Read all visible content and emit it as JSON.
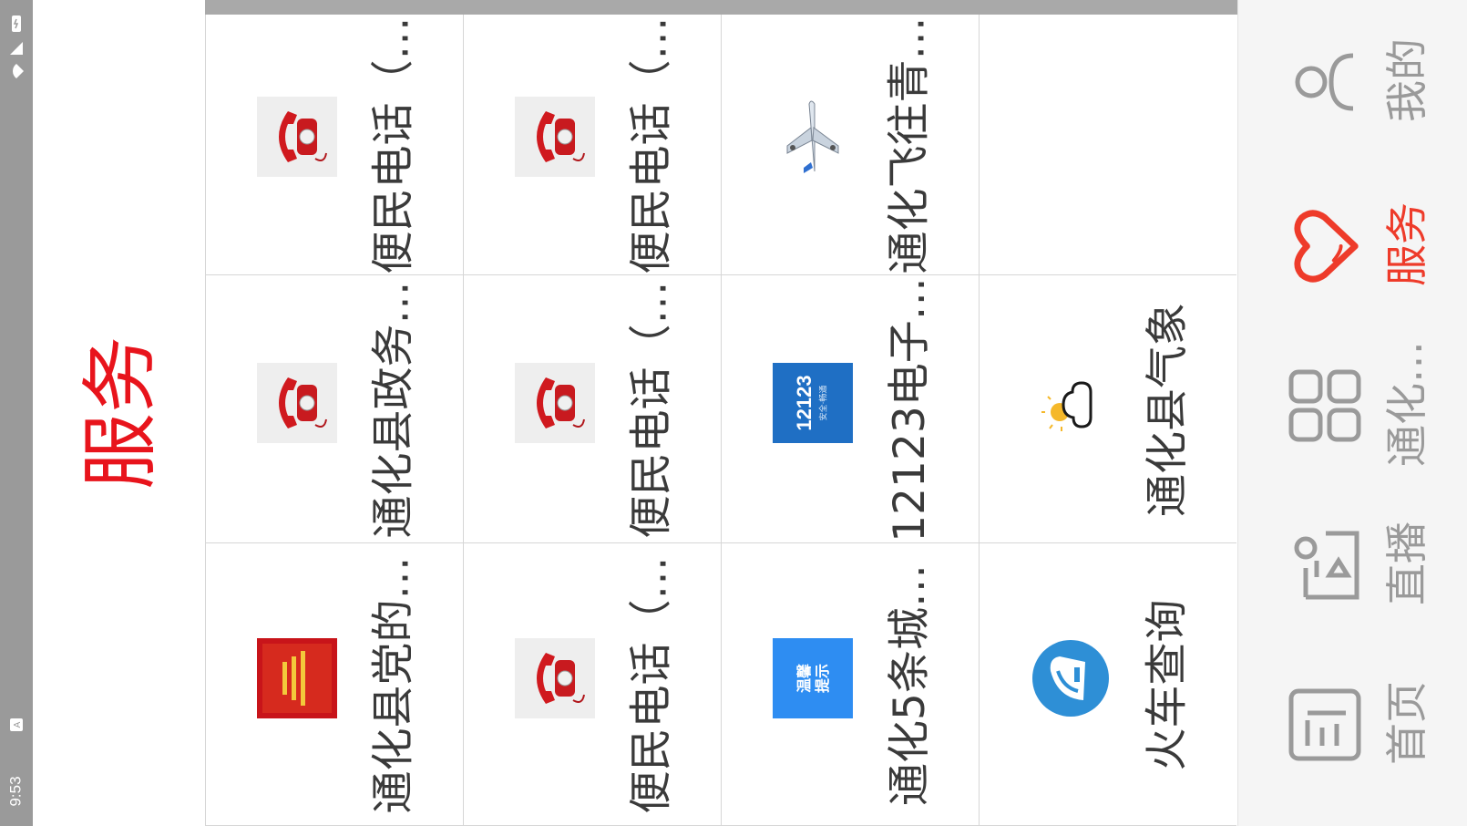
{
  "status_bar": {
    "time": "9:53",
    "notification_icon": "text-a-icon",
    "icons": [
      "battery-icon",
      "cellular-signal-icon",
      "wifi-icon"
    ]
  },
  "page_title": "服务",
  "accent_color": "#e8141c",
  "services": [
    {
      "label": "通化县党的…",
      "icon": "party-banner-thumb"
    },
    {
      "label": "通化县政务…",
      "icon": "red-telephone-thumb"
    },
    {
      "label": "便民电话（…",
      "icon": "red-telephone-thumb"
    },
    {
      "label": "便民电话（…",
      "icon": "red-telephone-thumb"
    },
    {
      "label": "便民电话（…",
      "icon": "red-telephone-thumb"
    },
    {
      "label": "便民电话（…",
      "icon": "red-telephone-thumb"
    },
    {
      "label": "通化5条城…",
      "icon": "warm-tips-thumb",
      "thumb_text": "温馨\n提示"
    },
    {
      "label": "12123电子…",
      "icon": "12123-app-thumb",
      "thumb_text": "12123"
    },
    {
      "label": "通化飞往青…",
      "icon": "airplane-thumb"
    },
    {
      "label": "火车查询",
      "icon": "train-thumb"
    },
    {
      "label": "通化县气象",
      "icon": "weather-cloud-thumb"
    }
  ],
  "nav": {
    "items": [
      {
        "label": "首页",
        "icon": "home-news-icon",
        "active": false
      },
      {
        "label": "直播",
        "icon": "live-broadcast-icon",
        "active": false
      },
      {
        "label": "通化…",
        "icon": "grid-apps-icon",
        "active": false
      },
      {
        "label": "服务",
        "icon": "heart-icon",
        "active": true
      },
      {
        "label": "我的",
        "icon": "user-profile-icon",
        "active": false
      }
    ],
    "active_color": "#ee3b2a",
    "inactive_color": "#9a9a9a"
  }
}
